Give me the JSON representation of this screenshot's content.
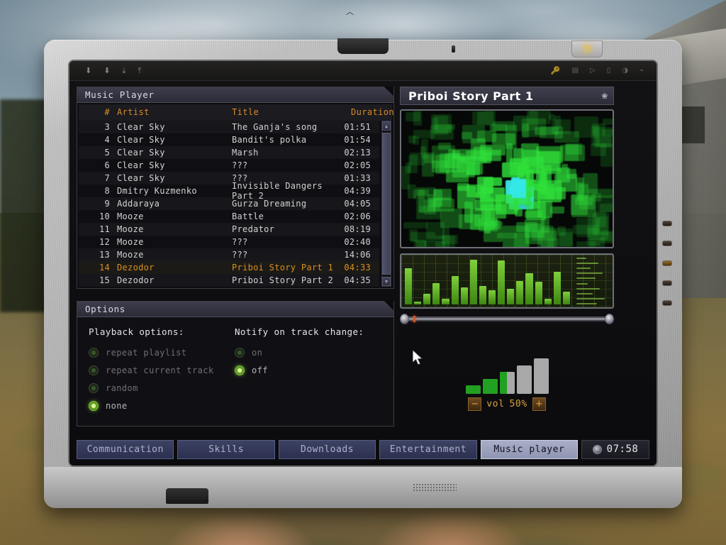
{
  "scene": {
    "setting": "outdoor-field-with-building"
  },
  "device": {
    "name": "pda-laptop",
    "power_glyph": "⏻"
  },
  "toolbar": {
    "left_icons": [
      "arrow-down-icon",
      "arrow-down-thin-icon",
      "arrow-down-bar-icon",
      "arrow-down-line-icon"
    ],
    "right_icons": [
      "key-icon",
      "window-icon",
      "play-icon",
      "device-icon",
      "sound-icon",
      "pin-icon"
    ]
  },
  "playlist_panel": {
    "title": "Music Player",
    "columns": {
      "num": "#",
      "artist": "Artist",
      "title": "Title",
      "duration": "Duration"
    },
    "tracks": [
      {
        "num": "3",
        "artist": "Clear Sky",
        "title": "The Ganja's song",
        "duration": "01:51",
        "playing": false
      },
      {
        "num": "4",
        "artist": "Clear Sky",
        "title": "Bandit's polka",
        "duration": "01:54",
        "playing": false
      },
      {
        "num": "5",
        "artist": "Clear Sky",
        "title": "Marsh",
        "duration": "02:13",
        "playing": false
      },
      {
        "num": "6",
        "artist": "Clear Sky",
        "title": "???",
        "duration": "02:05",
        "playing": false
      },
      {
        "num": "7",
        "artist": "Clear Sky",
        "title": "???",
        "duration": "01:33",
        "playing": false
      },
      {
        "num": "8",
        "artist": "Dmitry Kuzmenko",
        "title": "Invisible Dangers Part 2",
        "duration": "04:39",
        "playing": false
      },
      {
        "num": "9",
        "artist": "Addaraya",
        "title": "Gurza Dreaming",
        "duration": "04:05",
        "playing": false
      },
      {
        "num": "10",
        "artist": "Mooze",
        "title": "Battle",
        "duration": "02:06",
        "playing": false
      },
      {
        "num": "11",
        "artist": "Mooze",
        "title": "Predator",
        "duration": "08:19",
        "playing": false
      },
      {
        "num": "12",
        "artist": "Mooze",
        "title": "???",
        "duration": "02:40",
        "playing": false
      },
      {
        "num": "13",
        "artist": "Mooze",
        "title": "???",
        "duration": "14:06",
        "playing": false
      },
      {
        "num": "14",
        "artist": "Dezodor",
        "title": "Priboi Story Part 1",
        "duration": "04:33",
        "playing": true
      },
      {
        "num": "15",
        "artist": "Dezodor",
        "title": "Priboi Story Part 2",
        "duration": "04:35",
        "playing": false
      }
    ],
    "scrollbar": {
      "up": "▲",
      "down": "▼"
    }
  },
  "options_panel": {
    "title": "Options",
    "playback": {
      "heading": "Playback options:",
      "items": [
        {
          "label": "repeat playlist",
          "selected": false
        },
        {
          "label": "repeat current track",
          "selected": false
        },
        {
          "label": "random",
          "selected": false
        },
        {
          "label": "none",
          "selected": true
        }
      ]
    },
    "notify": {
      "heading": "Notify on track change:",
      "items": [
        {
          "label": "on",
          "selected": false
        },
        {
          "label": "off",
          "selected": true
        }
      ]
    }
  },
  "now_playing": {
    "title": "Priboi Story Part 1",
    "glyph": "❀",
    "visualizer_accent": "#2fe03a",
    "visualizer_highlight": "#35e8e8",
    "spectrum": [
      78,
      6,
      22,
      45,
      12,
      60,
      36,
      95,
      40,
      30,
      94,
      33,
      50,
      67,
      48,
      12,
      70,
      28
    ],
    "seek_percent": 4
  },
  "volume": {
    "label": "vol",
    "value": "50%",
    "percent": 50,
    "minus": "−",
    "plus": "+",
    "bar_count": 5,
    "bars_filled": 2.5
  },
  "tabbar": {
    "tabs": [
      {
        "label": "Communication",
        "active": false
      },
      {
        "label": "Skills",
        "active": false
      },
      {
        "label": "Downloads",
        "active": false
      },
      {
        "label": "Entertainment",
        "active": false
      },
      {
        "label": "Music player",
        "active": true
      }
    ],
    "clock": "07:58"
  }
}
